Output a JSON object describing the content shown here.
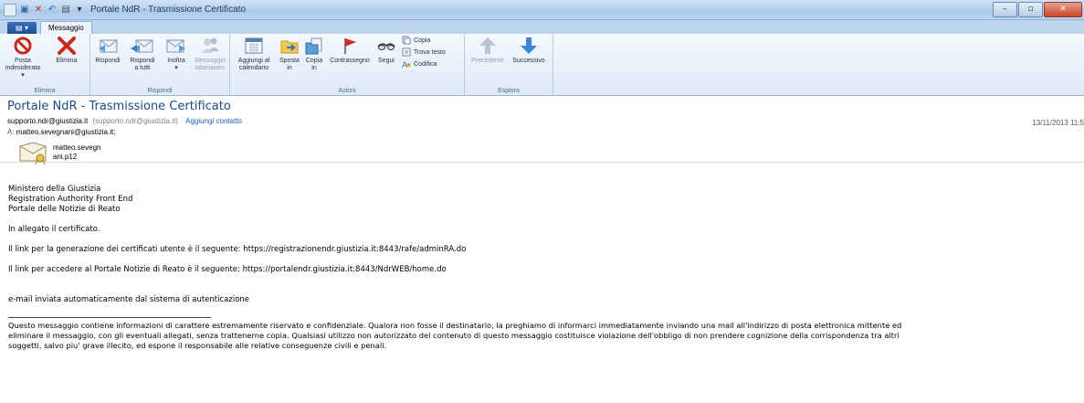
{
  "window": {
    "title": "Portale NdR - Trasmissione Certificato"
  },
  "tabs": {
    "file": "",
    "messaggio": "Messaggio"
  },
  "ribbon": {
    "groups": {
      "elimina": "Elimina",
      "rispondi": "Rispondi",
      "azioni": "Azioni",
      "esplora": "Esplora"
    },
    "buttons": {
      "posta_indesiderata_1": "Posta",
      "posta_indesiderata_2": "indesiderata ▾",
      "elimina": "Elimina",
      "rispondi": "Rispondi",
      "rispondi_tutti_1": "Rispondi",
      "rispondi_tutti_2": "a tutti",
      "inoltra_1": "Inoltra",
      "inoltra_2": "▾",
      "messaggio_1": "Messaggio",
      "messaggio_2": "istantaneo",
      "aggiungi_1": "Aggiungi al",
      "aggiungi_2": "calendario",
      "sposta_1": "Sposta",
      "sposta_2": "in",
      "copia_in_1": "Copia",
      "copia_in_2": "in",
      "contrassegno": "Contrassegno",
      "segui": "Segui",
      "copia": "Copia",
      "trova_testo": "Trova testo",
      "codifica": "Codifica",
      "precedente": "Precedente",
      "successivo": "Successivo"
    }
  },
  "message": {
    "subject": "Portale NdR - Trasmissione Certificato",
    "from_address": "supporto.ndr@giustizia.it",
    "from_paren": "(supporto.ndr@giustizia.it)",
    "add_contact": "Aggiungi contatto",
    "to_label": "A:",
    "to": "matteo.sevegnani@giustizia.it;",
    "date": "13/11/2013 11:5",
    "attachment_line1": "matteo.sevegn",
    "attachment_line2": "ani.p12"
  },
  "body": {
    "l1": "Ministero della Giustizia",
    "l2": "Registration Authority Front End",
    "l3": "Portale delle Notizie di Reato",
    "l4": "In allegato il certificato.",
    "l5": "Il link per la generazione dei certificati utente è il seguente: https://registrazionendr.giustizia.it:8443/rafe/adminRA.do",
    "l6": "Il link per accedere al Portale Notizie di Reato è il seguente: https://portalendr.giustizia.it:8443/NdrWEB/home.do",
    "l7": "e-mail inviata automaticamente dal sistema di autenticazione",
    "d1": "Questo messaggio contiene informazioni di carattere estremamente riservato e confidenziale. Qualora non fosse il destinatario, la preghiamo di informarci immediatamente inviando una mail all'indirizzo di posta elettronica mittente ed",
    "d2": "eliminare il messaggio, con gli eventuali allegati, senza trattenerne copia. Qualsiasi utilizzo non autorizzato del contenuto di questo messaggio costituisce violazione dell'obbligo di non prendere cognizione della corrispondenza tra altri",
    "d3": "soggetti, salvo piu' grave illecito, ed espone il responsabile alle relative conseguenze civili e penali."
  },
  "colors": {
    "subject": "#1f497d",
    "link": "#1f5fb0",
    "ribbon_label": "#4a6c95"
  }
}
